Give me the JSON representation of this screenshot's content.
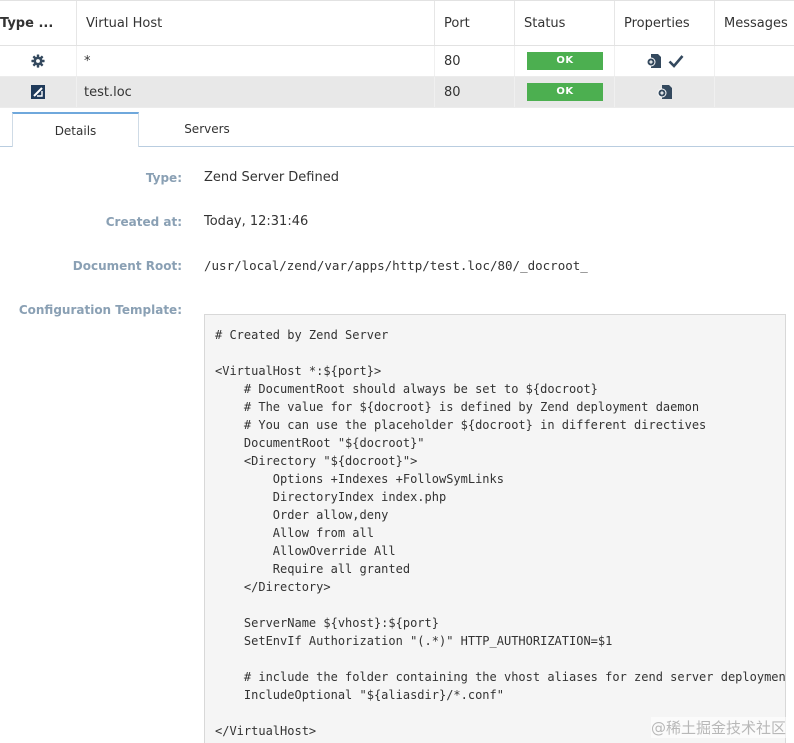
{
  "table": {
    "headers": {
      "type": "Type ...",
      "host": "Virtual Host",
      "port": "Port",
      "status": "Status",
      "properties": "Properties",
      "messages": "Messages"
    },
    "rows": [
      {
        "type_icon": "gear-icon",
        "host": "*",
        "port": "80",
        "status": "OK",
        "properties_icons": [
          "document-icon",
          "checkmark-icon"
        ]
      },
      {
        "type_icon": "zend-logo-icon",
        "host": "test.loc",
        "port": "80",
        "status": "OK",
        "properties_icons": [
          "document-icon"
        ]
      }
    ]
  },
  "tabs": [
    {
      "label": "Details",
      "active": true
    },
    {
      "label": "Servers",
      "active": false
    }
  ],
  "details": {
    "type_label": "Type:",
    "type_value": "Zend Server Defined",
    "created_label": "Created at:",
    "created_value": "Today, 12:31:46",
    "docroot_label": "Document Root:",
    "docroot_value": "/usr/local/zend/var/apps/http/test.loc/80/_docroot_",
    "template_label": "Configuration Template:",
    "template_text": "# Created by Zend Server\n\n<VirtualHost *:${port}>\n    # DocumentRoot should always be set to ${docroot}\n    # The value for ${docroot} is defined by Zend deployment daemon\n    # You can use the placeholder ${docroot} in different directives\n    DocumentRoot \"${docroot}\"\n    <Directory \"${docroot}\">\n        Options +Indexes +FollowSymLinks\n        DirectoryIndex index.php\n        Order allow,deny\n        Allow from all\n        AllowOverride All\n        Require all granted\n    </Directory>\n\n    ServerName ${vhost}:${port}\n    SetEnvIf Authorization \"(.*)\" HTTP_AUTHORIZATION=$1\n\n    # include the folder containing the vhost aliases for zend server deployment\n    IncludeOptional \"${aliasdir}/*.conf\"\n\n</VirtualHost>"
  },
  "watermark": "@稀土掘金技术社区",
  "colors": {
    "ok_green": "#4caf50",
    "label_blue_gray": "#8aa0b4",
    "tab_accent": "#6fa8dc",
    "selected_row": "#e8e8e8",
    "template_bg": "#f5f5f5"
  }
}
